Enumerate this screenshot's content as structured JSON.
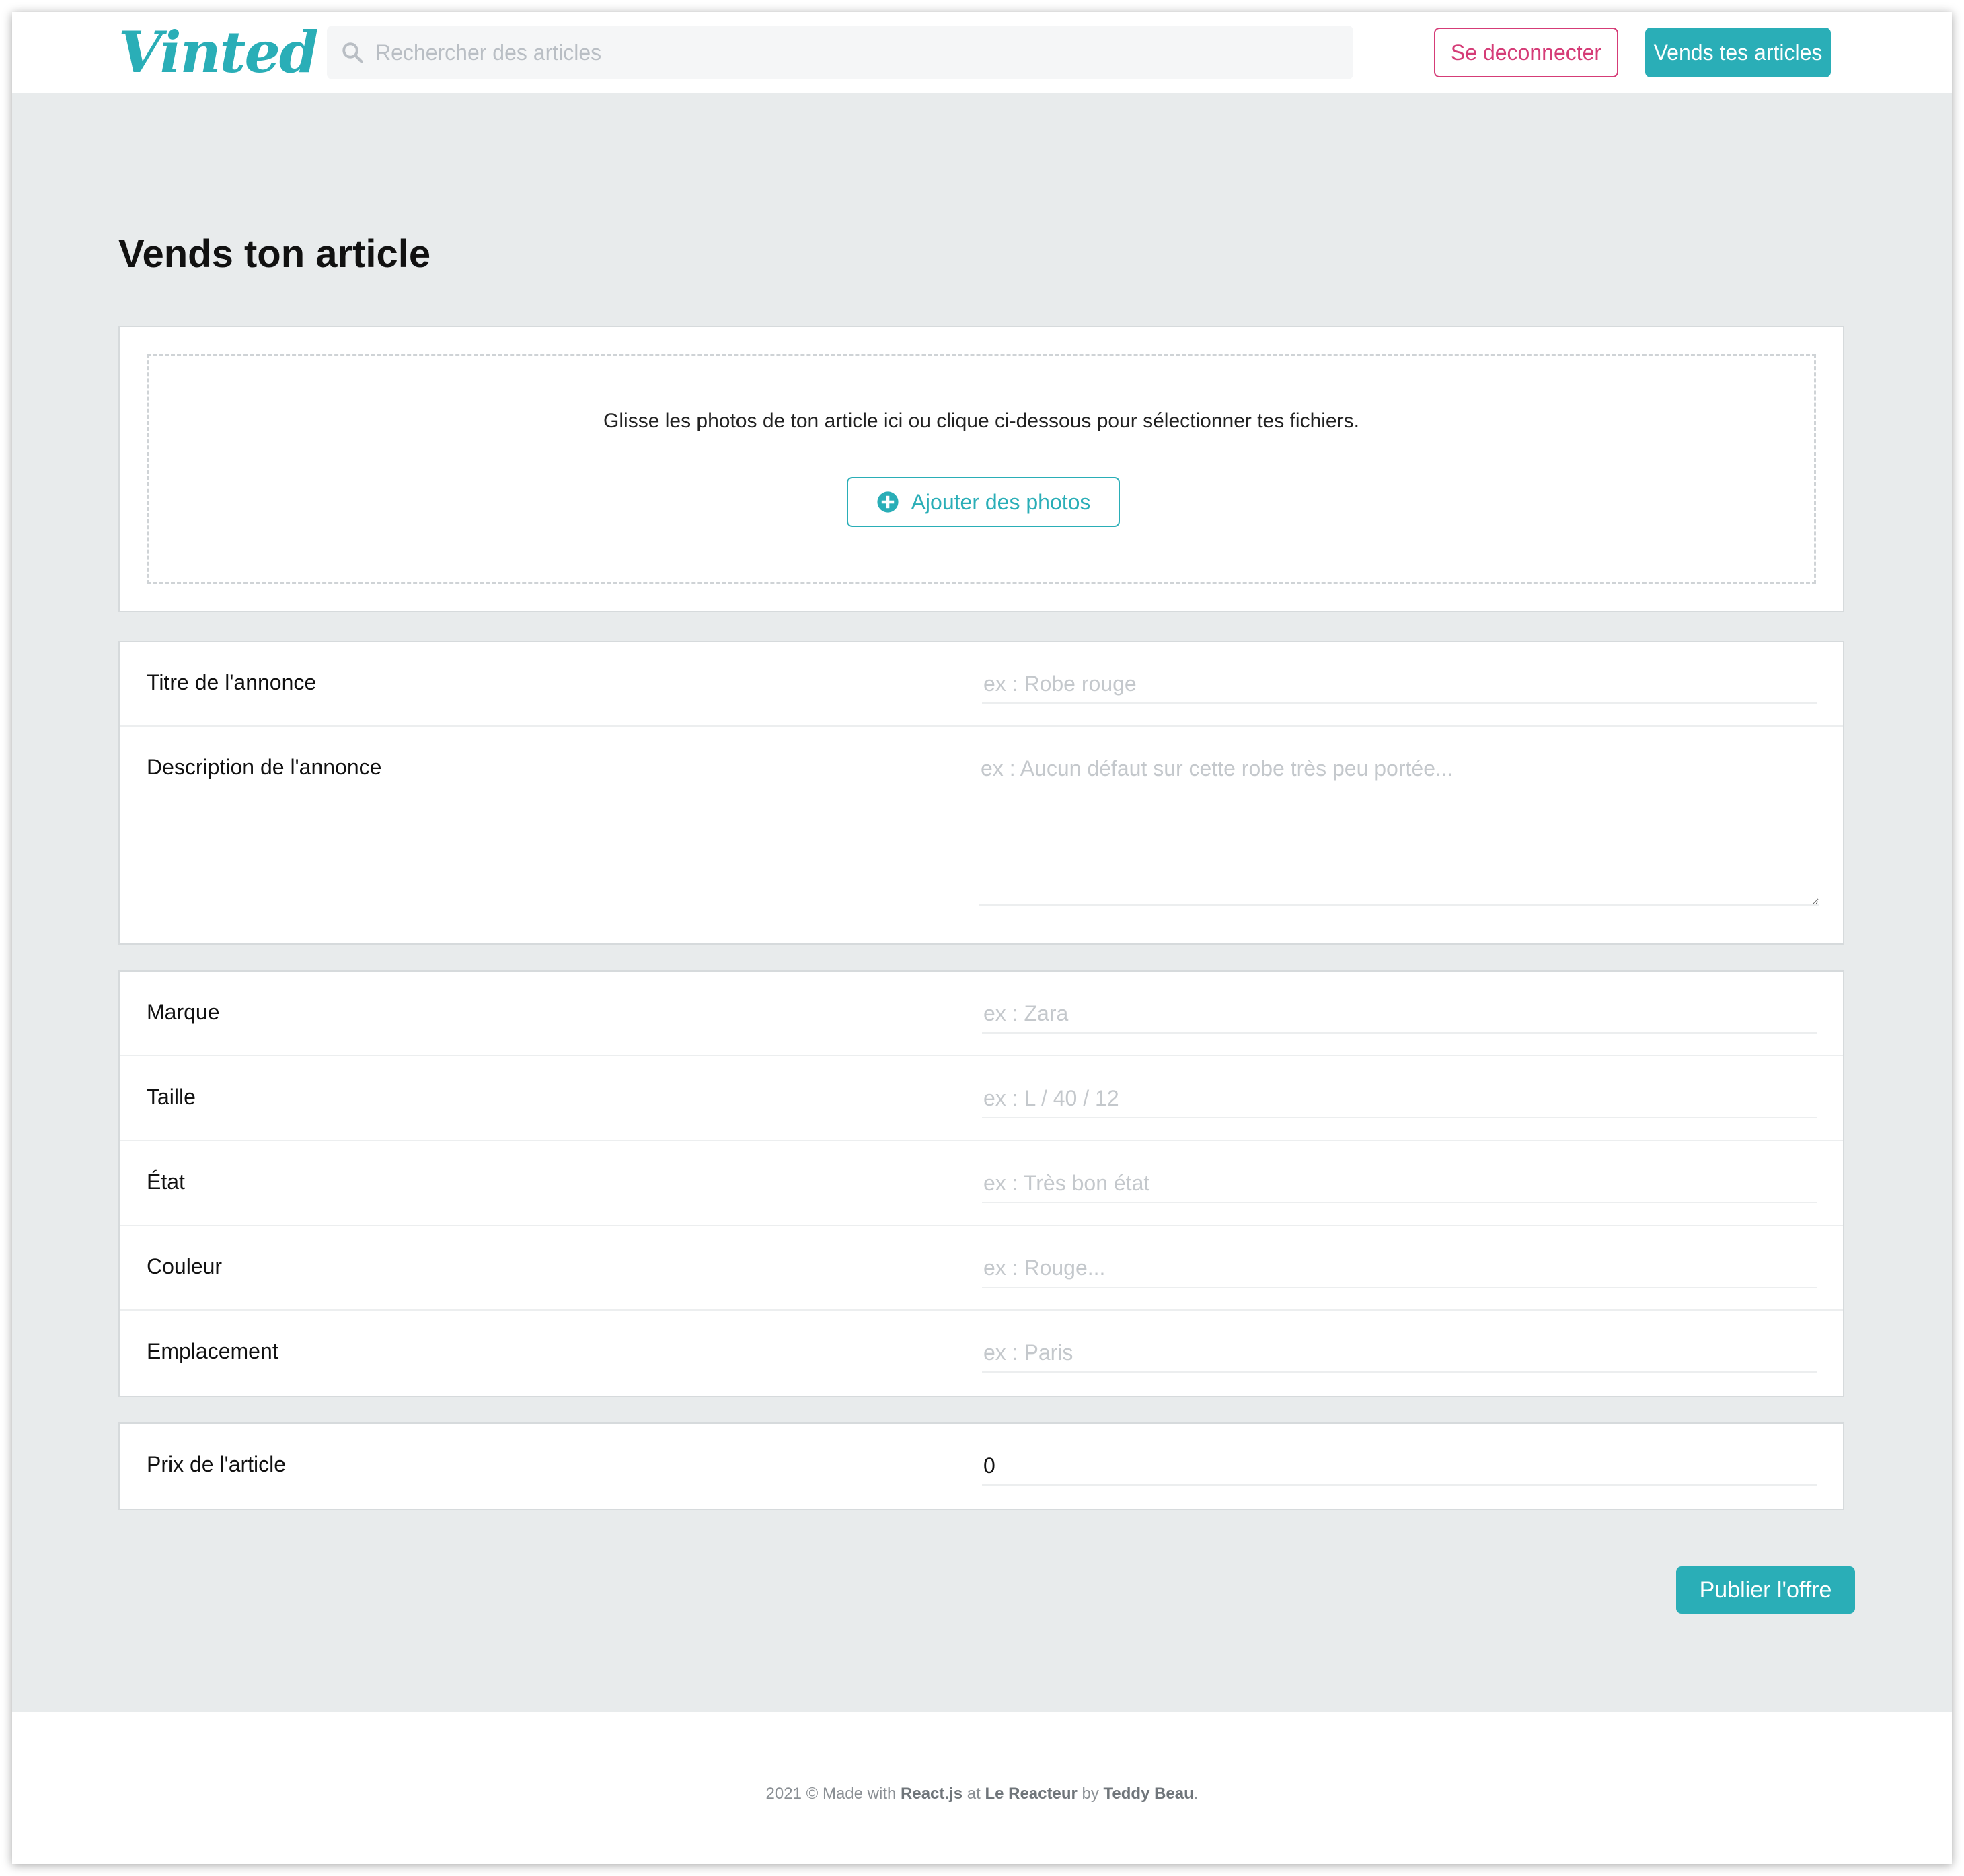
{
  "header": {
    "logo": "Vinted",
    "search_placeholder": "Rechercher des articles",
    "logout_label": "Se deconnecter",
    "sell_label": "Vends tes articles"
  },
  "page": {
    "title": "Vends ton article"
  },
  "photos": {
    "instruction": "Glisse les photos de ton article ici ou clique ci-dessous pour sélectionner tes fichiers.",
    "add_label": "Ajouter des photos"
  },
  "form": {
    "title": {
      "label": "Titre de l'annonce",
      "placeholder": "ex : Robe rouge"
    },
    "description": {
      "label": "Description de l'annonce",
      "placeholder": "ex : Aucun défaut sur cette robe très peu portée..."
    },
    "brand": {
      "label": "Marque",
      "placeholder": "ex : Zara"
    },
    "size": {
      "label": "Taille",
      "placeholder": "ex : L / 40 / 12"
    },
    "condition": {
      "label": "État",
      "placeholder": "ex : Très bon état"
    },
    "color": {
      "label": "Couleur",
      "placeholder": "ex : Rouge..."
    },
    "location": {
      "label": "Emplacement",
      "placeholder": "ex : Paris"
    },
    "price": {
      "label": "Prix de l'article",
      "value": "0"
    }
  },
  "actions": {
    "publish_label": "Publier l'offre"
  },
  "footer": {
    "prefix": "2021 © Made with ",
    "tech": "React.js",
    "at": " at ",
    "school": "Le Reacteur",
    "by": " by ",
    "author": "Teddy Beau",
    "suffix": "."
  },
  "colors": {
    "accent": "#2aaeb7",
    "logout": "#d53c77",
    "background": "#e8ebec"
  }
}
